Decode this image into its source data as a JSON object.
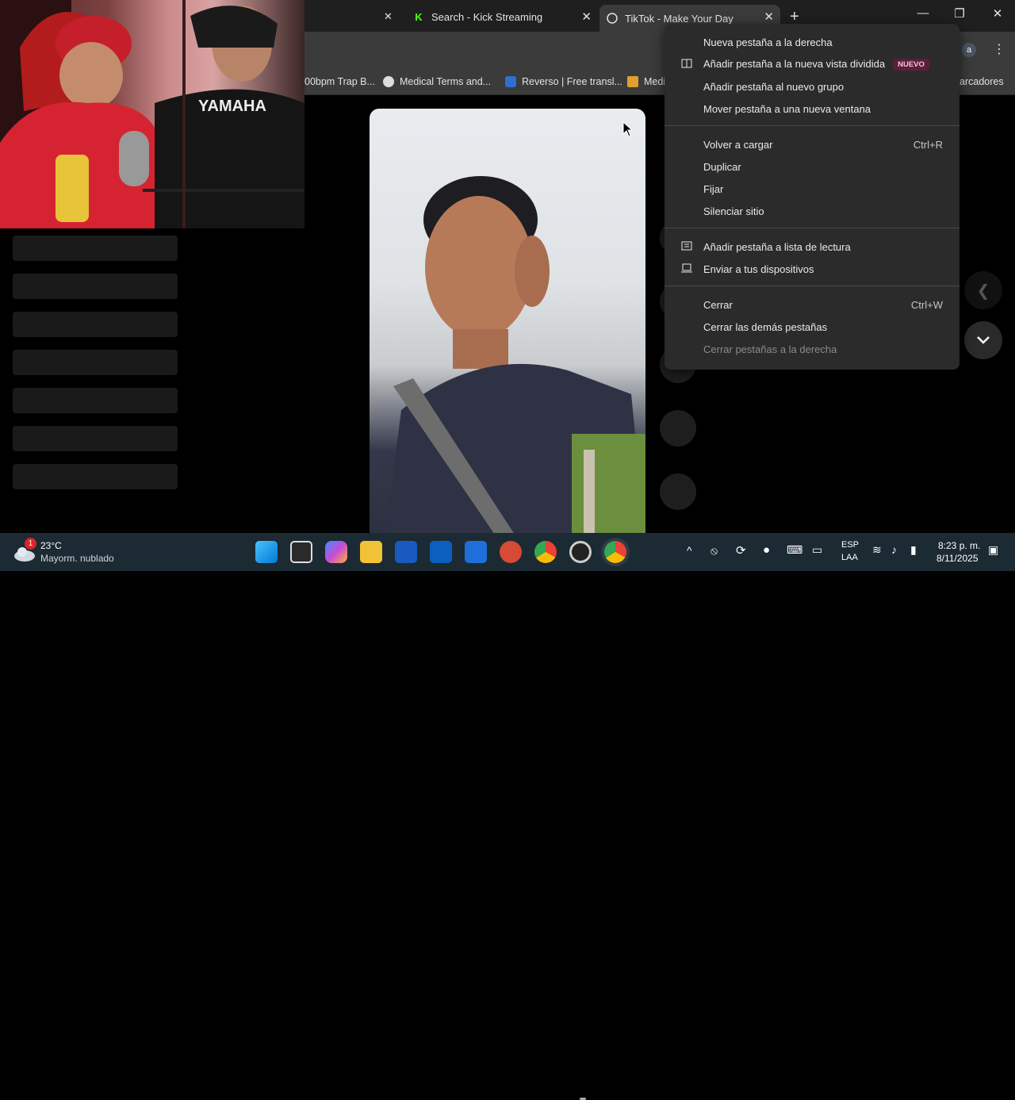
{
  "browser": {
    "tabs": [
      {
        "title": "Search - Kick Streaming",
        "favicon": "K",
        "active": false
      },
      {
        "title": "TikTok - Make Your Day",
        "favicon": "tiktok",
        "active": true
      }
    ],
    "new_tab_symbol": "+",
    "profile_initial": "a",
    "bookmarks": [
      {
        "label": "00bpm Trap B..."
      },
      {
        "label": "Medical Terms and..."
      },
      {
        "label": "Reverso | Free transl..."
      },
      {
        "label": "Medi"
      },
      {
        "label": "arcadores"
      }
    ]
  },
  "context_menu": {
    "items": [
      {
        "label": "Nueva pestaña a la derecha"
      },
      {
        "label": "Añadir pestaña a la nueva vista dividida",
        "badge": "NUEVO"
      },
      {
        "label": "Añadir pestaña al nuevo grupo"
      },
      {
        "label": "Mover pestaña a una nueva ventana"
      },
      {
        "label": "Volver a cargar",
        "shortcut": "Ctrl+R"
      },
      {
        "label": "Duplicar"
      },
      {
        "label": "Fijar"
      },
      {
        "label": "Silenciar sitio"
      },
      {
        "label": "Añadir pestaña a lista de lectura"
      },
      {
        "label": "Enviar a tus dispositivos"
      },
      {
        "label": "Cerrar",
        "shortcut": "Ctrl+W"
      },
      {
        "label": "Cerrar las demás pestañas"
      },
      {
        "label": "Cerrar pestañas a la derecha",
        "disabled": true
      }
    ]
  },
  "taskbar": {
    "weather": {
      "temp": "23°C",
      "desc": "Mayorm. nublado",
      "alert_count": "1"
    },
    "lang": {
      "line1": "ESP",
      "line2": "LAA"
    },
    "clock": {
      "time": "8:23 p. m.",
      "date": "8/11/2025"
    }
  },
  "colors": {
    "accent_kick": "#53fc18",
    "badge_bg": "#5b1e3c",
    "menu_bg": "#2b2b2b"
  }
}
